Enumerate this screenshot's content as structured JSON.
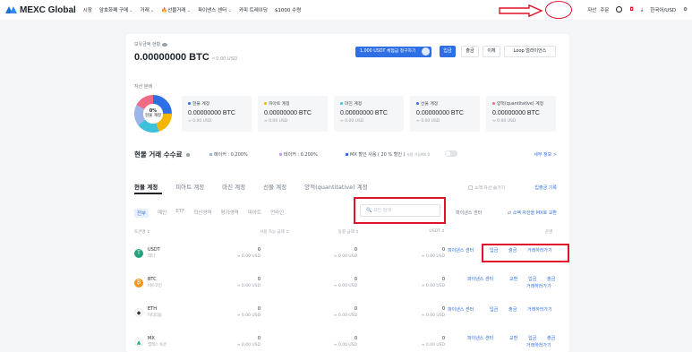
{
  "nav": {
    "logo": "MEXC Global",
    "items": [
      {
        "label": "시장",
        "caret": false,
        "fire": false
      },
      {
        "label": "암호화폐 구매",
        "caret": true,
        "fire": false
      },
      {
        "label": "거래",
        "caret": true,
        "fire": false
      },
      {
        "label": "선물거래",
        "caret": true,
        "fire": true
      },
      {
        "label": "파이낸스 센터",
        "caret": true,
        "fire": false
      },
      {
        "label": "카피 트레이딩",
        "caret": false,
        "fire": false
      },
      {
        "label": "$1000 수령",
        "caret": false,
        "fire": false
      }
    ],
    "assets": "자산",
    "orders": "주문",
    "lang_currency": "한국어/USD"
  },
  "summary": {
    "hold_label": "보유금액 현황",
    "balance": "0.00000000 BTC",
    "balance_usd": "≈ 0.00 USD",
    "promo": "1,000 USDT 체험금 청구하기",
    "deposit": "입금",
    "withdraw": "출금",
    "transfer": "이체",
    "loop": "Loop 얼라이언스",
    "dist_label": "자산 분배",
    "donut_pct": "0%",
    "donut_label": "현물 계정",
    "accounts": [
      {
        "name": "현물 계정",
        "value": "0.00000000 BTC",
        "usd": "≈ 0.00 USD",
        "color": "#2f6fe6"
      },
      {
        "name": "피아트 계정",
        "value": "0.00000000 BTC",
        "usd": "≈ 0.00 USD",
        "color": "#f7b500"
      },
      {
        "name": "마진 계정",
        "value": "0.00000000 BTC",
        "usd": "≈ 0.00 USD",
        "color": "#3cc1d8"
      },
      {
        "name": "선물 계정",
        "value": "0.00000000 BTC",
        "usd": "≈ 0.00 USD",
        "color": "#2f6fe6"
      },
      {
        "name": "양적(quantitative) 계정",
        "value": "0.00000000 BTC",
        "usd": "≈ 0.00 USD",
        "color": "#f06a86"
      }
    ],
    "fee_title": "현물 거래 수수료",
    "maker_fee": "메이커 : 0.200%",
    "taker_fee": "테이커 : 0.200%",
    "mx_discount": "MX 할인 사용 ( 20 % 할인 )",
    "mx_available": "사용 가능MX 0",
    "more_info": "세부 정보 >"
  },
  "accounts_panel": {
    "tabs": [
      "현물 계정",
      "피아트 계정",
      "마진 계정",
      "선물 계정",
      "양적(quantitative) 계정"
    ],
    "hide_small": "소액 자산 숨기기",
    "deposit_record": "입출금 기록",
    "filters": [
      "전부",
      "메인",
      "ETF",
      "혁신영역",
      "평가영역",
      "피아트",
      "언라인"
    ],
    "search_placeholder": "코인 검색",
    "futures_center": "파이낸스 센터",
    "convert_mx": "소액 자산을 MX로 교환",
    "headers": {
      "coin": "토큰명 ↕",
      "available": "사용 가능 금액 ↕",
      "frozen": "동결 금액 ↕",
      "usdt": "USDT ↕",
      "action": "운영"
    },
    "rows": [
      {
        "symbol": "USDT",
        "name": "테더",
        "available": "0",
        "available_usd": "≈ 0.00 USD",
        "frozen": "0",
        "frozen_usd": "≈ 0.00 USD",
        "usdt": "0",
        "usdt_usd": "≈ 0.00 USD",
        "icon_color": "#26a17b",
        "icon_glyph": "T",
        "finance": "파이낸스 센터",
        "deposit": "입금",
        "withdraw": "출금",
        "trade": "거래하러가기"
      },
      {
        "symbol": "BTC",
        "name": "비트코인",
        "available": "0",
        "available_usd": "≈ 0.00 USD",
        "frozen": "0",
        "frozen_usd": "≈ 0.00 USD",
        "usdt": "0",
        "usdt_usd": "≈ 0.00 USD",
        "icon_color": "#f7931a",
        "icon_glyph": "₿",
        "finance": "파이낸스 센터",
        "exchange": "교환",
        "deposit": "입금",
        "withdraw": "출금",
        "trade": "거래하러가기"
      },
      {
        "symbol": "ETH",
        "name": "이더리움",
        "available": "0",
        "available_usd": "≈ 0.00 USD",
        "frozen": "0",
        "frozen_usd": "≈ 0.00 USD",
        "usdt": "0",
        "usdt_usd": "≈ 0.00 USD",
        "icon_color": "#ffffff",
        "icon_glyph": "◆",
        "finance": "파이낸스 센터",
        "deposit": "입금",
        "withdraw": "출금",
        "trade": "거래하러가기"
      },
      {
        "symbol": "MX",
        "name": "엠엑스 토큰",
        "available": "0",
        "available_usd": "≈ 0.00 USD",
        "frozen": "0",
        "frozen_usd": "≈ 0.00 USD",
        "usdt": "0",
        "usdt_usd": "≈ 0.00 USD",
        "icon_color": "#ffffff",
        "icon_glyph": "▲",
        "finance": "파이낸스 센터",
        "exchange": "교환",
        "deposit": "입금",
        "withdraw": "출금",
        "trade": "거래하러가기"
      }
    ]
  }
}
